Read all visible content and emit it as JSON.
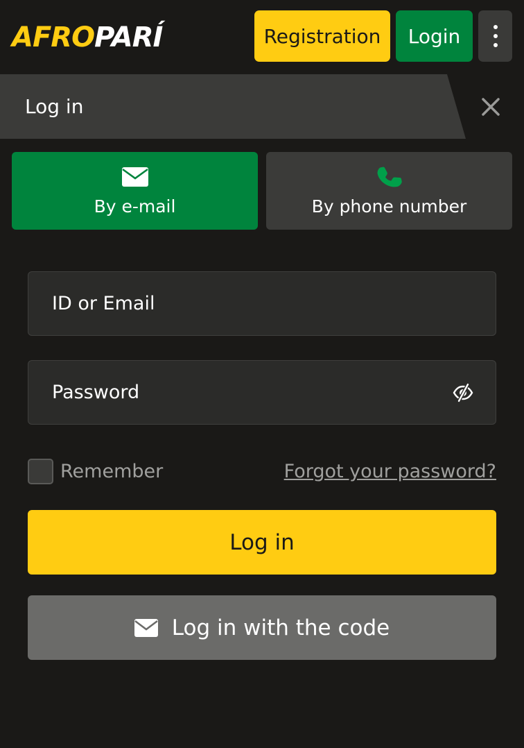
{
  "header": {
    "logo_part1": "AFRO",
    "logo_part2": "PARÍ",
    "registration_label": "Registration",
    "login_label": "Login",
    "more_icon": "kebab-menu-icon"
  },
  "dialog": {
    "title": "Log in",
    "close_icon": "close-icon"
  },
  "tabs": [
    {
      "label": "By e-mail",
      "icon": "envelope-icon",
      "active": true
    },
    {
      "label": "By phone number",
      "icon": "phone-icon",
      "active": false
    }
  ],
  "form": {
    "id_placeholder": "ID or Email",
    "password_placeholder": "Password",
    "password_toggle_icon": "eye-off-icon",
    "remember_label": "Remember",
    "remember_checked": false,
    "forgot_label": "Forgot your password?",
    "submit_label": "Log in",
    "code_label": "Log in with the code",
    "code_icon": "envelope-icon"
  },
  "colors": {
    "background": "#1a1917",
    "brand_yellow": "#ffcc12",
    "brand_green": "#00843d",
    "panel": "#3b3b39",
    "input_bg": "#2b2b29",
    "secondary_button": "#6b6b69",
    "muted_text": "#a0a09e"
  }
}
